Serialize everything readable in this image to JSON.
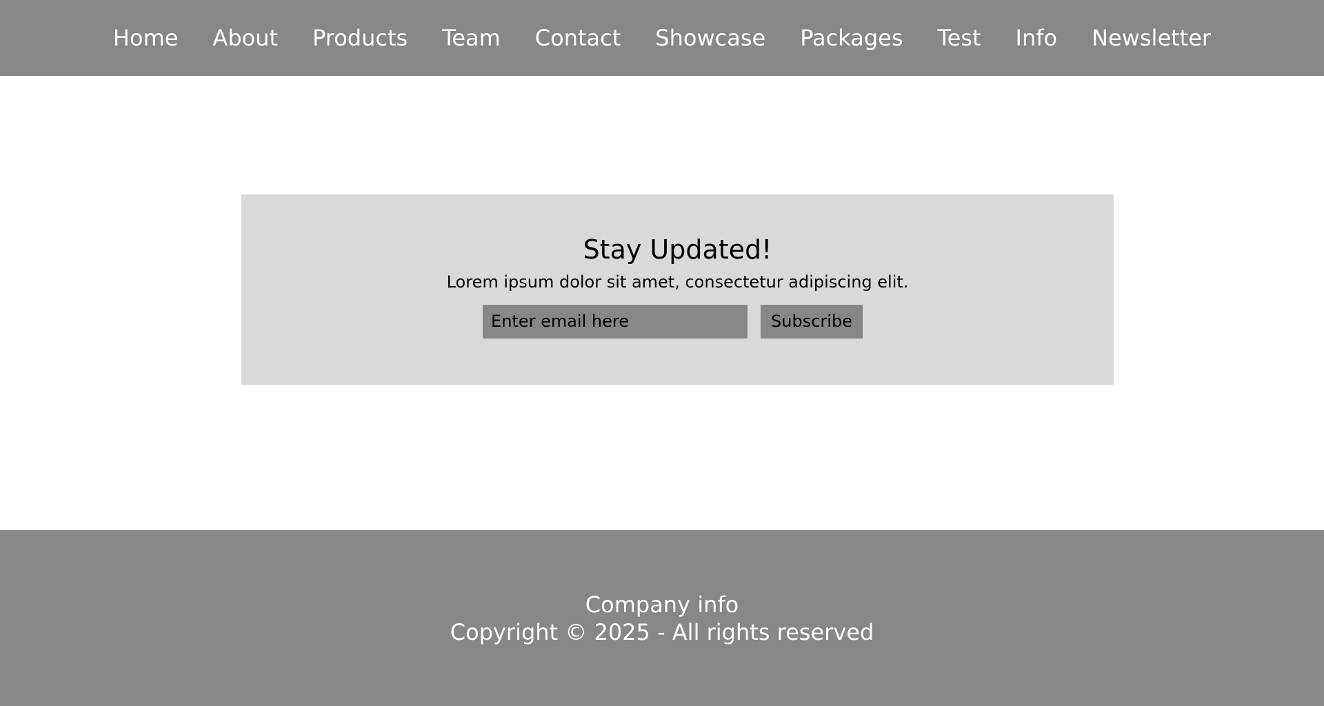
{
  "nav": {
    "items": [
      {
        "label": "Home"
      },
      {
        "label": "About"
      },
      {
        "label": "Products"
      },
      {
        "label": "Team"
      },
      {
        "label": "Contact"
      },
      {
        "label": "Showcase"
      },
      {
        "label": "Packages"
      },
      {
        "label": "Test"
      },
      {
        "label": "Info"
      },
      {
        "label": "Newsletter"
      }
    ]
  },
  "newsletter": {
    "title": "Stay Updated!",
    "description": "Lorem ipsum dolor sit amet, consectetur adipiscing elit.",
    "email_placeholder": "Enter email here",
    "subscribe_label": "Subscribe"
  },
  "footer": {
    "company_info": "Company info",
    "copyright": "Copyright © 2025 - All rights reserved"
  },
  "colors": {
    "header_bg": "#878787",
    "card_bg": "#d9d9d9",
    "footer_bg": "#878787",
    "control_bg": "#878787",
    "page_bg": "#ffffff"
  }
}
